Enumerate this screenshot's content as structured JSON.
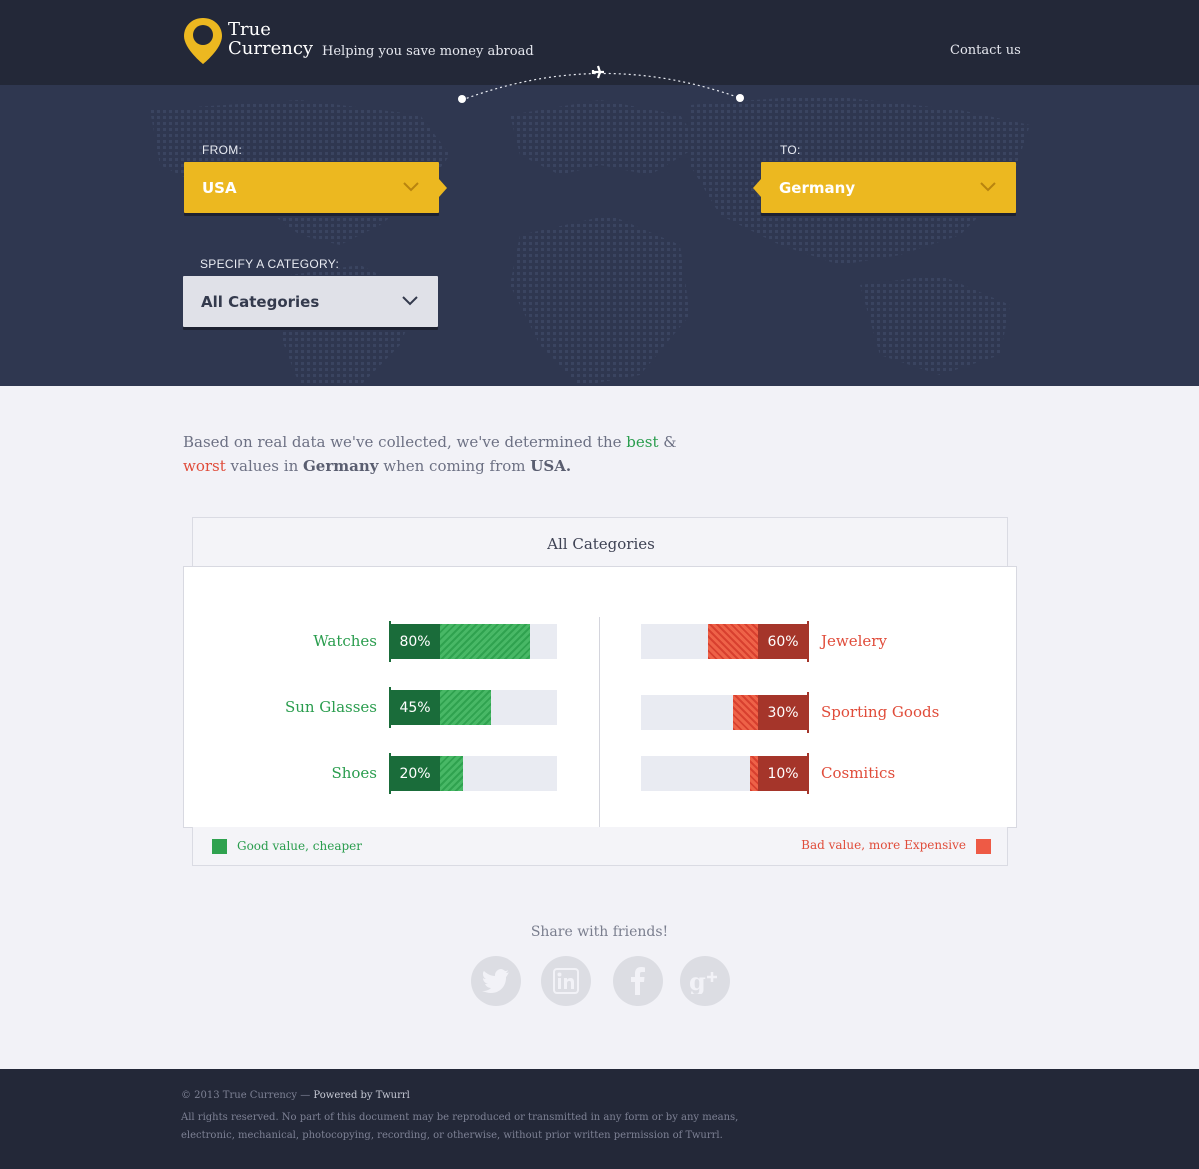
{
  "header": {
    "logo_line1": "True",
    "logo_line2": "Currency",
    "tagline": "Helping you save money abroad",
    "contact": "Contact us"
  },
  "search": {
    "from_label": "FROM:",
    "from_value": "USA",
    "to_label": "TO:",
    "to_value": "Germany",
    "category_label": "SPECIFY A CATEGORY:",
    "category_value": "All Categories"
  },
  "intro": {
    "part1": "Based on real data we've collected, we've determined the ",
    "best": "best",
    "amp": " &",
    "worst": "worst",
    "part2": " values in ",
    "country": "Germany",
    "part3": " when coming from ",
    "origin": "USA."
  },
  "chart_data": {
    "type": "bar",
    "title": "All Categories",
    "series": [
      {
        "name": "Good value, cheaper",
        "color": "#2a9d4e",
        "categories": [
          "Watches",
          "Sun Glasses",
          "Shoes"
        ],
        "values": [
          80,
          45,
          20
        ],
        "labels": [
          "80%",
          "45%",
          "20%"
        ]
      },
      {
        "name": "Bad value, more Expensive",
        "color": "#e04c3a",
        "categories": [
          "Jewelery",
          "Sporting Goods",
          "Cosmitics"
        ],
        "values": [
          60,
          30,
          10
        ],
        "labels": [
          "60%",
          "30%",
          "10%"
        ]
      }
    ]
  },
  "legend": {
    "good": "Good value, cheaper",
    "bad": "Bad value, more Expensive"
  },
  "share": {
    "title": "Share with friends!",
    "networks": [
      "twitter",
      "linkedin",
      "facebook",
      "google-plus"
    ]
  },
  "footer": {
    "copyright": "© 2013 True Currency — ",
    "powered": "Powered by Twurrl",
    "legal": "All rights reserved. No part of this document may be reproduced or transmitted in any form or by any means, electronic, mechanical, photocopying, recording, or otherwise, without prior written permission of Twurrl."
  }
}
